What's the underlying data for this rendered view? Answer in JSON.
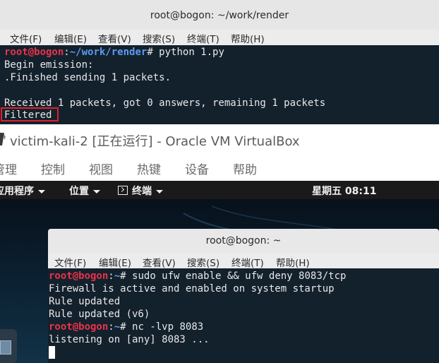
{
  "host_terminal": {
    "title": "root@bogon: ~/work/render",
    "menu": [
      "文件(F)",
      "编辑(E)",
      "查看(V)",
      "搜索(S)",
      "终端(T)",
      "帮助(H)"
    ],
    "prompt_user": "root@bogon",
    "prompt_sep": ":",
    "prompt_path": "~/work/render",
    "prompt_symbol": "# ",
    "command": "python 1.py",
    "output": [
      "Begin emission:",
      ".Finished sending 1 packets.",
      "",
      "Received 1 packets, got 0 answers, remaining 1 packets",
      "Filtered"
    ],
    "highlight_color": "#e0202a"
  },
  "virtualbox": {
    "title": "victim-kali-2 [正在运行] - Oracle VM VirtualBox",
    "menu": [
      "管理",
      "控制",
      "视图",
      "热键",
      "设备",
      "帮助"
    ]
  },
  "guest_panel": {
    "applications": "应用程序",
    "places": "位置",
    "terminal": "终端",
    "clock": "星期五 08:11"
  },
  "guest_terminal": {
    "title": "root@bogon: ~",
    "menu": [
      "文件(F)",
      "编辑(E)",
      "查看(V)",
      "搜索(S)",
      "终端(T)",
      "帮助(H)"
    ],
    "prompt_user": "root@bogon",
    "prompt_sep": ":",
    "prompt_path": "~",
    "prompt_symbol": "# ",
    "command1": "sudo ufw enable && ufw deny 8083/tcp",
    "output1": [
      "Firewall is active and enabled on system startup",
      "Rule updated",
      "Rule updated (v6)"
    ],
    "command2": "nc -lvp 8083",
    "output2": "listening on [any] 8083 ..."
  },
  "colors": {
    "prompt_user": "#e8334a",
    "prompt_path": "#5c9bf0",
    "terminal_bg": "#13212d"
  }
}
